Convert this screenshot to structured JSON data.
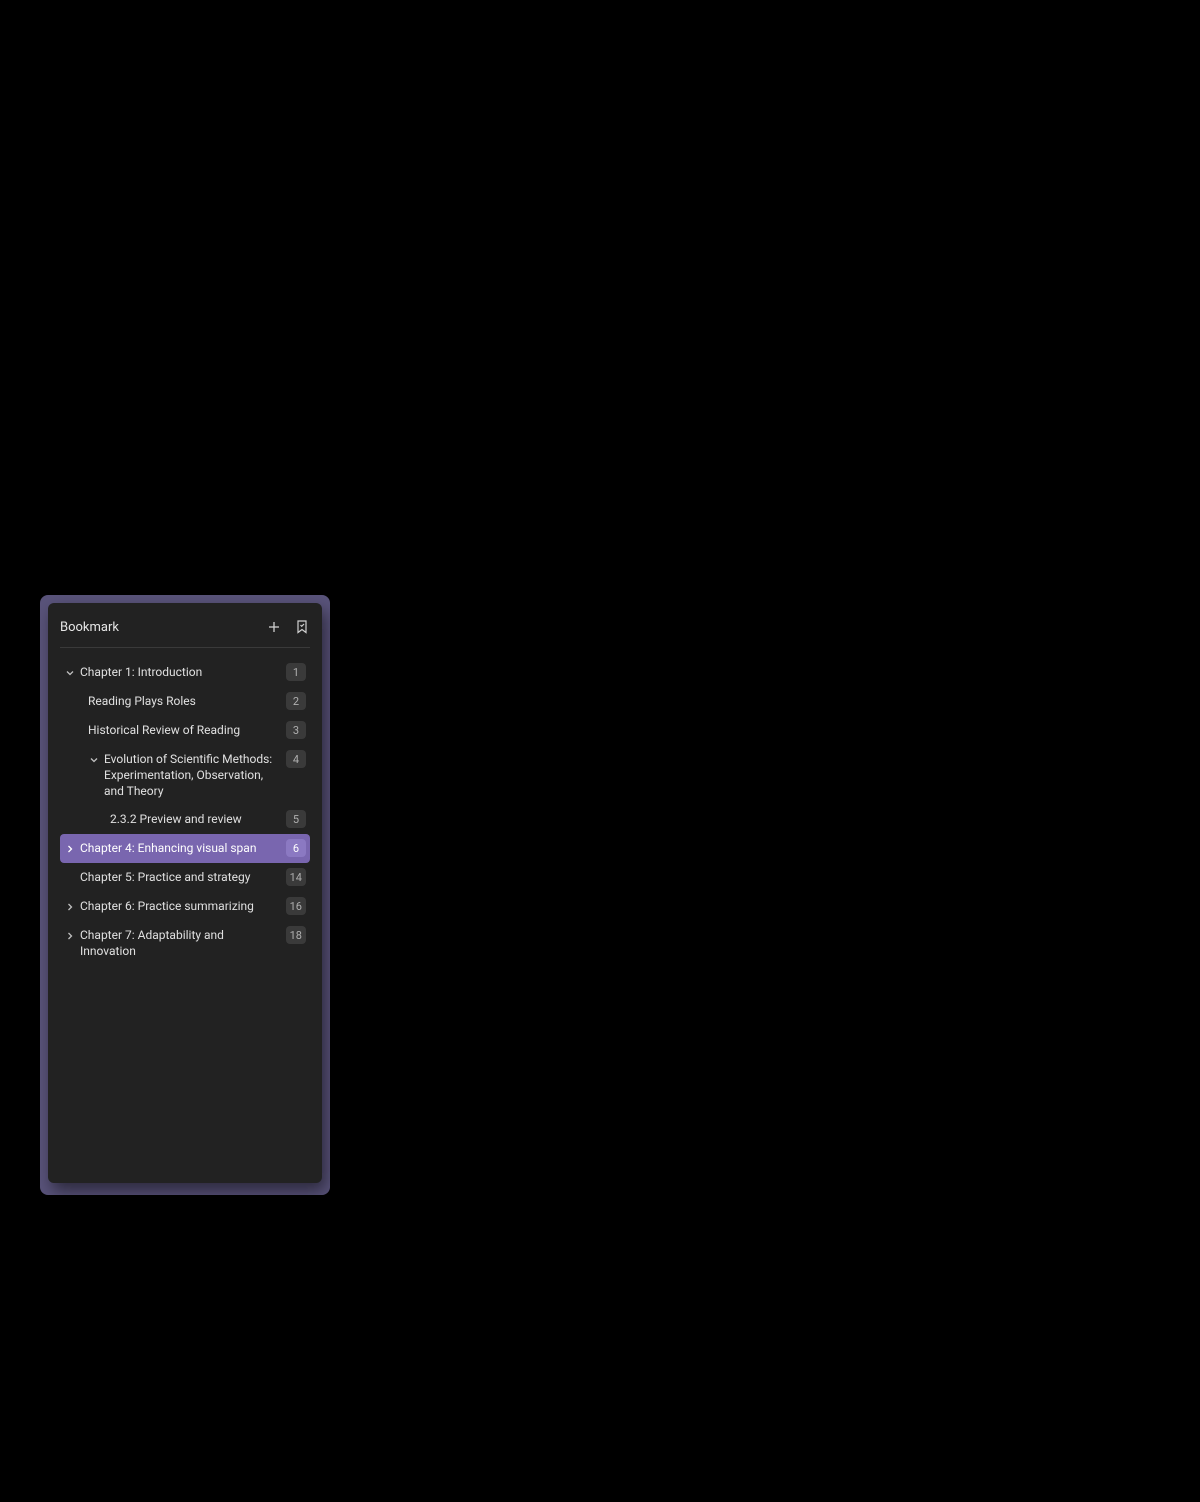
{
  "panel": {
    "title": "Bookmark"
  },
  "items": [
    {
      "label": "Chapter 1: Introduction",
      "page": "1",
      "level": 0,
      "chevron": "down",
      "active": false
    },
    {
      "label": "Reading Plays Roles",
      "page": "2",
      "level": 1,
      "chevron": null,
      "active": false
    },
    {
      "label": "Historical Review of Reading",
      "page": "3",
      "level": 1,
      "chevron": null,
      "active": false
    },
    {
      "label": "Evolution of Scientific Methods: Experimentation, Observation, and Theory",
      "page": "4",
      "level": 1,
      "chevron": "down",
      "active": false
    },
    {
      "label": "2.3.2 Preview and review",
      "page": "5",
      "level": 2,
      "chevron": null,
      "active": false
    },
    {
      "label": "Chapter 4: Enhancing visual span",
      "page": "6",
      "level": 0,
      "chevron": "right",
      "active": true
    },
    {
      "label": "Chapter 5: Practice and strategy",
      "page": "14",
      "level": 0,
      "chevron": null,
      "active": false
    },
    {
      "label": "Chapter 6: Practice summarizing",
      "page": "16",
      "level": 0,
      "chevron": "right",
      "active": false
    },
    {
      "label": "Chapter 7: Adaptability and Innovation",
      "page": "18",
      "level": 0,
      "chevron": "right",
      "active": false
    }
  ]
}
